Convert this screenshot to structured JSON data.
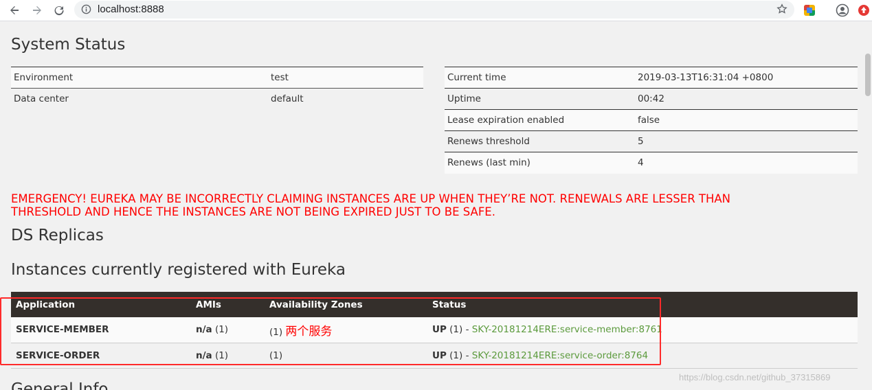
{
  "browser": {
    "url": "localhost:8888"
  },
  "system_status": {
    "title": "System Status",
    "left": [
      {
        "key": "Environment",
        "value": "test"
      },
      {
        "key": "Data center",
        "value": "default"
      }
    ],
    "right": [
      {
        "key": "Current time",
        "value": "2019-03-13T16:31:04 +0800"
      },
      {
        "key": "Uptime",
        "value": "00:42"
      },
      {
        "key": "Lease expiration enabled",
        "value": "false"
      },
      {
        "key": "Renews threshold",
        "value": "5"
      },
      {
        "key": "Renews (last min)",
        "value": "4"
      }
    ]
  },
  "emergency": {
    "line1": "EMERGENCY! EUREKA MAY BE INCORRECTLY CLAIMING INSTANCES ARE UP WHEN THEY’RE NOT. RENEWALS ARE LESSER THAN",
    "line2": "THRESHOLD AND HENCE THE INSTANCES ARE NOT BEING EXPIRED JUST TO BE SAFE."
  },
  "ds_replicas": {
    "title": "DS Replicas"
  },
  "instances": {
    "title": "Instances currently registered with Eureka",
    "headers": [
      "Application",
      "AMIs",
      "Availability Zones",
      "Status"
    ],
    "rows": [
      {
        "application": "SERVICE-MEMBER",
        "amis_bold": "n/a",
        "amis_count": "(1)",
        "zones": "(1)",
        "note": "两个服务",
        "status_bold": "UP",
        "status_count": "(1) -",
        "link": "SKY-20181214ERE:service-member:8761"
      },
      {
        "application": "SERVICE-ORDER",
        "amis_bold": "n/a",
        "amis_count": "(1)",
        "zones": "(1)",
        "note": "",
        "status_bold": "UP",
        "status_count": "(1) -",
        "link": "SKY-20181214ERE:service-order:8764"
      }
    ]
  },
  "general_info": {
    "title": "General Info"
  },
  "watermark": "https://blog.csdn.net/github_37315869",
  "colors": {
    "emergency": "#ff0000",
    "header_bg": "#342f2b",
    "link": "#5b9a3c",
    "annotation_box": "#ff2a2a"
  },
  "icons": [
    "back-icon",
    "forward-icon",
    "reload-icon",
    "info-icon",
    "star-icon",
    "extension-icon",
    "account-icon",
    "extension-red-icon"
  ]
}
